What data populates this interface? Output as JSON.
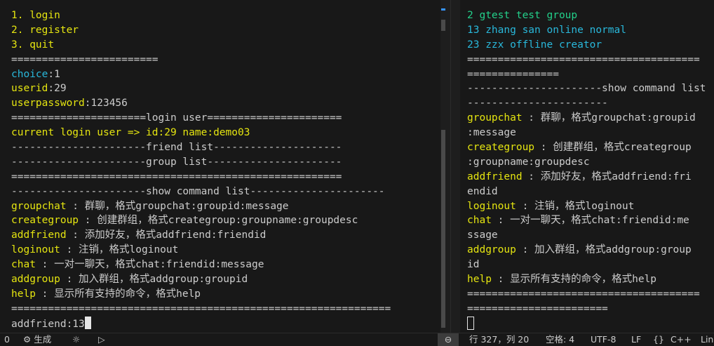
{
  "left_terminal": {
    "menu": [
      "1. login",
      "2. register",
      "3. quit"
    ],
    "divider_short": "========================",
    "choice_key": "choice",
    "choice_value": "1",
    "userid_key": "userid",
    "userid_value": "29",
    "password_key": "userpassword",
    "password_value": "123456",
    "login_banner": "======================login user======================",
    "current_login": "current login user => id:29 name:demo03",
    "friend_list": "----------------------friend list---------------------",
    "group_list": "----------------------group list----------------------",
    "divider_long": "======================================================",
    "show_command": "----------------------show command list----------------------",
    "commands": [
      {
        "k": "groupchat",
        "d": " : 群聊，格式groupchat:groupid:message"
      },
      {
        "k": "creategroup",
        "d": " : 创建群组，格式creategroup:groupname:groupdesc"
      },
      {
        "k": "addfriend",
        "d": " : 添加好友，格式addfriend:friendid"
      },
      {
        "k": "loginout",
        "d": " : 注销，格式loginout"
      },
      {
        "k": "chat",
        "d": " : 一对一聊天，格式chat:friendid:message"
      },
      {
        "k": "addgroup",
        "d": " : 加入群组，格式addgroup:groupid"
      },
      {
        "k": "help",
        "d": " : 显示所有支持的命令，格式help"
      }
    ],
    "divider_end": "==============================================================",
    "input_line": "addfriend:13"
  },
  "right_terminal": {
    "entries": [
      "2 gtest test group",
      "13 zhang san online normal",
      "23 zzx offline creator"
    ],
    "divider_a": "======================================",
    "divider_a2": "===============",
    "show_command_a": "----------------------show command list",
    "show_command_b": "-----------------------",
    "cmd_lines": [
      {
        "k": "groupchat",
        "d": " : 群聊，格式groupchat:groupid"
      },
      {
        "k": "",
        "d": ":message"
      },
      {
        "k": "creategroup",
        "d": " : 创建群组，格式creategroup"
      },
      {
        "k": "",
        "d": ":groupname:groupdesc"
      },
      {
        "k": "addfriend",
        "d": " : 添加好友，格式addfriend:fri"
      },
      {
        "k": "",
        "d": "endid"
      },
      {
        "k": "loginout",
        "d": " : 注销，格式loginout"
      },
      {
        "k": "chat",
        "d": " : 一对一聊天，格式chat:friendid:me"
      },
      {
        "k": "",
        "d": "ssage"
      },
      {
        "k": "addgroup",
        "d": " : 加入群组，格式addgroup:group"
      },
      {
        "k": "",
        "d": "id"
      },
      {
        "k": "help",
        "d": " : 显示所有支持的命令，格式help"
      }
    ],
    "divider_b": "======================================",
    "divider_b2": "======================="
  },
  "statusbar": {
    "problems": "0",
    "build": "生成",
    "line_col": "行 327，列 20",
    "spaces": "空格: 4",
    "encoding": "UTF-8",
    "eol": "LF",
    "braces": "{}",
    "language": "C++",
    "extra": "Lin"
  },
  "colors": {
    "yellow": "#e5e510",
    "cyan": "#29b8db",
    "green": "#23d18b",
    "background": "#181818"
  }
}
